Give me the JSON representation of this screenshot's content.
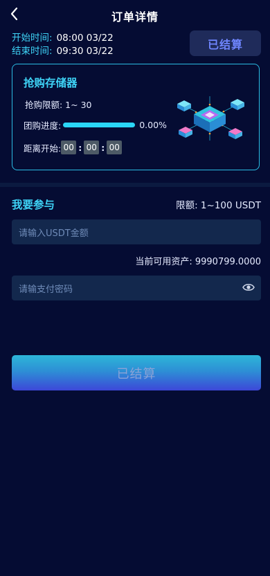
{
  "header": {
    "title": "订单详情"
  },
  "times": {
    "start_label": "开始时间:",
    "start_value": "08:00 03/22",
    "end_label": "结束时间:",
    "end_value": "09:30 03/22"
  },
  "status_badge": "已结算",
  "card": {
    "title": "抢购存储器",
    "limit_text": "抢购限额: 1~ 30",
    "progress_label": "团购进度:",
    "progress_value": 1.0,
    "progress_percent": "0.00%",
    "countdown_label": "距离开始:",
    "countdown": [
      "00",
      "00",
      "00"
    ],
    "countdown_sep": ":"
  },
  "join": {
    "title": "我要参与",
    "limit_text": "限额: 1~100 USDT"
  },
  "usdt_input": {
    "placeholder": "请输入USDT金额",
    "value": ""
  },
  "assets_text": "当前可用资产: 9990799.0000",
  "password_input": {
    "placeholder": "请输支付密码",
    "value": ""
  },
  "submit_label": "已结算",
  "colors": {
    "background": "#050c33",
    "accent": "#3ed3f6",
    "progress": "#2ad6f7",
    "badge_text": "#6f86ff",
    "input_bg": "#13284d"
  },
  "icons": {
    "back": "chevron-left-icon",
    "eye": "eye-icon",
    "illustration": "storage-server-illustration"
  }
}
